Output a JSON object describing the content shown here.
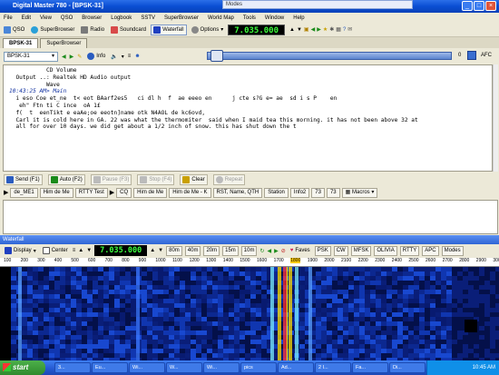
{
  "window": {
    "title": "Digital Master 780 - [BPSK-31]",
    "popup_title": "Modes"
  },
  "menu": [
    "File",
    "Edit",
    "View",
    "QSO",
    "Browser",
    "Logbook",
    "SSTV",
    "SuperBrowser",
    "World Map",
    "Tools",
    "Window",
    "Help"
  ],
  "toolbar": {
    "qso": "QSO",
    "superbrowser": "SuperBrowser",
    "radio": "Radio",
    "soundcard": "Soundcard",
    "waterfall": "Waterfall",
    "options": "Options",
    "frequency": "7.035.000"
  },
  "tabs": [
    "BPSK-31",
    "SuperBrowser"
  ],
  "mode": {
    "selected": "BPSK-31",
    "info": "Info",
    "value": "0",
    "afc": "AFC"
  },
  "rx_lines": [
    {
      "text": "           CD Volume",
      "stamp": false
    },
    {
      "text": "  Output ..: Realtek HD Audio output",
      "stamp": false
    },
    {
      "text": "           Wave",
      "stamp": false
    },
    {
      "text": "",
      "stamp": false
    },
    {
      "text": "10:43:25 AM> Main",
      "stamp": true
    },
    {
      "text": "  i eso Coe et_ne  t< eot BAarf2es5   ci dl h  f  ae eeeo en      j cte s?G e= ae  sd i s P    en",
      "stamp": false
    },
    {
      "text": "",
      "stamp": false
    },
    {
      "text": "   eh\" Ftn ti C ince  oA 1£",
      "stamp": false
    },
    {
      "text": "  f(  t  eenTikt e eaAe;oe eeotn]name otk N4AOL de kc6ovd,",
      "stamp": false
    },
    {
      "text": "",
      "stamp": false
    },
    {
      "text": "  Carl it is cold here in GA. 22 was what the thermomiter  said when I maid tea this morning. it has not been above 32 at",
      "stamp": false
    },
    {
      "text": "  all for over 10 days. we did get about a 1/2 inch of snow. this has shut down the t",
      "stamp": false
    }
  ],
  "tx_buttons": [
    "Send (F1)",
    "Auto (F2)",
    "Pause (F3)",
    "Stop (F4)",
    "Clear",
    "Repeat"
  ],
  "macros": [
    "de_ME1",
    "Him de Me",
    "RTTY Test",
    "CQ",
    "Him de Me",
    "Him de Me - K",
    "RST, Name, QTH",
    "Station",
    "Info2",
    "73",
    "73",
    "Macros"
  ],
  "waterfall": {
    "title": "Waterfall",
    "display": "Display",
    "center": "Center",
    "frequency": "7.035.000",
    "bands": [
      "80m",
      "40m",
      "20m",
      "15m",
      "10m"
    ],
    "faves": "Faves",
    "modes": [
      "PSK",
      "CW",
      "MFSK",
      "OLIVIA",
      "RTTY",
      "APC",
      "Modes"
    ],
    "scale": [
      "100",
      "200",
      "300",
      "400",
      "500",
      "600",
      "700",
      "800",
      "900",
      "1000",
      "1100",
      "1200",
      "1300",
      "1400",
      "1500",
      "1600",
      "1700",
      "1800",
      "1900",
      "2000",
      "2100",
      "2200",
      "2300",
      "2400",
      "2500",
      "2600",
      "2700",
      "2800",
      "2900",
      "3000"
    ],
    "marker": "1800"
  },
  "taskbar": {
    "start": "start",
    "tasks": [
      "3...",
      "Eu...",
      "Wi...",
      "W...",
      "Wi...",
      "pics",
      "Ad...",
      "2 I...",
      "Fa...",
      "Di..."
    ],
    "time": "10:45 AM"
  },
  "colors": {
    "freq_fg": "#3cff3c",
    "titlebar": "#0a4ed3",
    "waterfall_bg": "#000000"
  }
}
